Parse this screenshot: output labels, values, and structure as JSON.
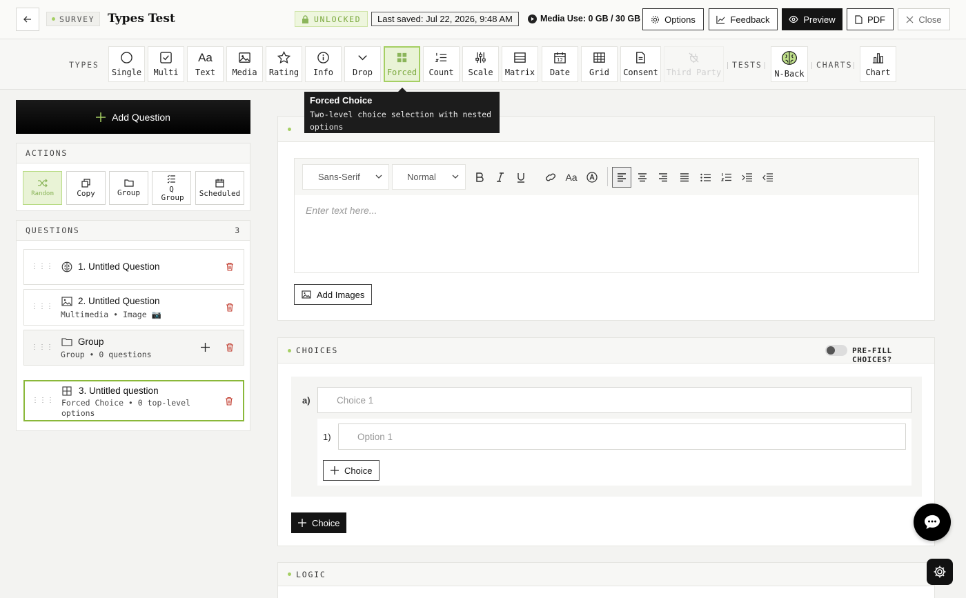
{
  "header": {
    "tag": "SURVEY",
    "title": "Types Test",
    "lock_status": "UNLOCKED",
    "last_saved": "Last saved: Jul 22, 2026, 9:48 AM",
    "media_use": "Media Use: 0 GB / 30 GB",
    "buttons": {
      "options": "Options",
      "feedback": "Feedback",
      "preview": "Preview",
      "pdf": "PDF",
      "close": "Close"
    }
  },
  "typesbar": {
    "types_label": "TYPES",
    "types": [
      "Single",
      "Multi",
      "Text",
      "Media",
      "Rating",
      "Info",
      "Drop",
      "Forced",
      "Count",
      "Scale",
      "Matrix",
      "Date",
      "Grid",
      "Consent",
      "Third Party"
    ],
    "active_type": "Forced",
    "disabled_type": "Third Party",
    "tests_label": "TESTS",
    "tests": [
      "N-Back"
    ],
    "charts_label": "CHARTS",
    "charts": [
      "Chart"
    ]
  },
  "tooltip": {
    "title": "Forced Choice",
    "description": "Two-level choice selection with nested options"
  },
  "sidebar": {
    "add_question": "Add Question",
    "actions_label": "ACTIONS",
    "actions": [
      "Random",
      "Copy",
      "Group",
      "Q Group",
      "Scheduled"
    ],
    "questions_label": "QUESTIONS",
    "questions_count": "3",
    "questions": [
      {
        "title": "1. Untitled Question",
        "subtitle": ""
      },
      {
        "title": "2. Untitled Question",
        "subtitle": "Multimedia • Image 📷"
      },
      {
        "title": "Group",
        "subtitle": "Group • 0 questions"
      },
      {
        "title": "3. Untitled question",
        "subtitle": "Forced Choice • 0 top-level options"
      }
    ]
  },
  "editor": {
    "font_family": "Sans-Serif",
    "font_size": "Normal",
    "placeholder": "Enter text here...",
    "add_images": "Add Images"
  },
  "choices": {
    "label": "CHOICES",
    "prefill_label": "PRE-FILL CHOICES?",
    "choice_letter": "a)",
    "choice_placeholder": "Choice 1",
    "option_number": "1)",
    "option_placeholder": "Option 1",
    "nested_add": "Choice",
    "add_choice": "Choice"
  },
  "logic": {
    "label": "LOGIC"
  },
  "colors": {
    "accent": "#a5cf63",
    "accent_dark": "#7aa83d",
    "trash": "#c0392b"
  }
}
